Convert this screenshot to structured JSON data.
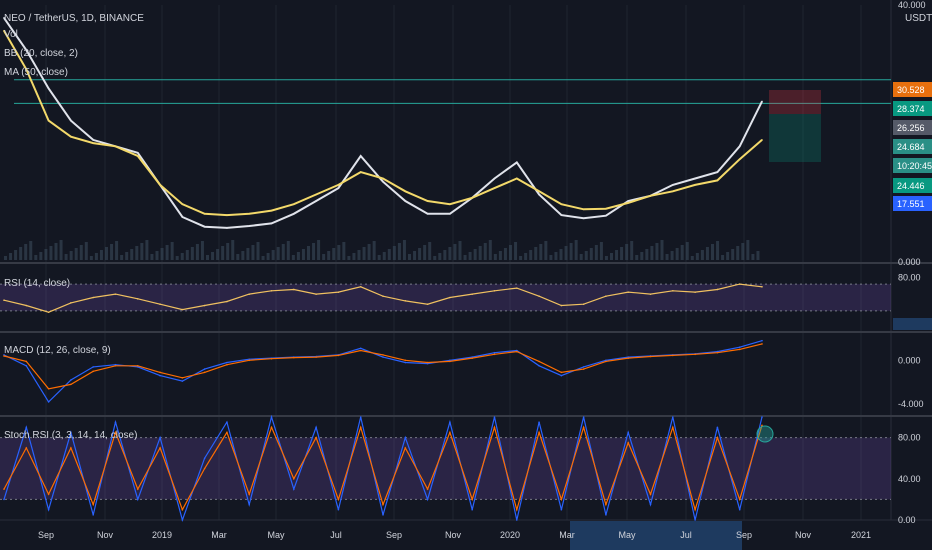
{
  "header": {
    "symbol_title": "NEO / TetherUS, 1D, BINANCE",
    "currency": "USDT",
    "indicators": [
      "Vol",
      "BB (20, close, 2)",
      "MA (50, close)"
    ]
  },
  "chart_data": [
    {
      "type": "line",
      "pane": "price",
      "title": "NEO / TetherUS, 1D, BINANCE",
      "ylim": [
        0,
        40
      ],
      "y_ticks": [
        "40.000",
        "0.000"
      ],
      "x_ticks": [
        "Sep",
        "Nov",
        "2019",
        "Mar",
        "May",
        "Jul",
        "Sep",
        "Nov",
        "2020",
        "Mar",
        "May",
        "Jul",
        "Sep",
        "Nov",
        "2021"
      ],
      "series": [
        {
          "name": "BB (20, close, 2)",
          "color": "#e0e3eb",
          "values": [
            38,
            33,
            27,
            22,
            19,
            18,
            17,
            12,
            7,
            5.5,
            5.3,
            5.6,
            6,
            7.5,
            9.5,
            11.5,
            16.5,
            12.5,
            9.5,
            7.5,
            7.5,
            10,
            13,
            15.5,
            10.5,
            7.3,
            6.8,
            7.2,
            9.5,
            10.3,
            12,
            13,
            14,
            18,
            25
          ]
        },
        {
          "name": "MA (50, close)",
          "color": "#f3d96a",
          "values": [
            36,
            30,
            22,
            19.5,
            18.5,
            18,
            16.5,
            12,
            9,
            7.5,
            7.3,
            7.5,
            8,
            9,
            10.5,
            12,
            14,
            13,
            11,
            9.5,
            9,
            10,
            11.5,
            13,
            11,
            9,
            8.2,
            8.3,
            9.2,
            10.3,
            11,
            12,
            12.7,
            16,
            19
          ]
        }
      ],
      "levels": [
        {
          "value": 28.374,
          "color": "#26a69a"
        },
        {
          "value": 24.684,
          "color": "#26a69a"
        }
      ],
      "price_tags": [
        {
          "text": "30.528",
          "bg": "#e8700e"
        },
        {
          "text": "28.374",
          "bg": "#089981"
        },
        {
          "text": "26.256",
          "bg": "#555a68"
        },
        {
          "text": "24.684",
          "bg": "#2a8f86"
        },
        {
          "text": "10:20:45",
          "bg": "#2a8f86"
        },
        {
          "text": "24.446",
          "bg": "#089981"
        },
        {
          "text": "17.551",
          "bg": "#2962ff"
        }
      ]
    },
    {
      "type": "line",
      "pane": "rsi",
      "title": "RSI (14, close)",
      "y_ticks": [
        "80.00"
      ],
      "ylim": [
        0,
        100
      ],
      "band": [
        30,
        70
      ],
      "series": [
        {
          "name": "RSI",
          "color": "#f0c160",
          "values": [
            46,
            38,
            28,
            42,
            50,
            55,
            48,
            40,
            32,
            38,
            44,
            55,
            60,
            62,
            55,
            58,
            66,
            52,
            45,
            40,
            50,
            55,
            60,
            64,
            52,
            38,
            40,
            52,
            58,
            55,
            60,
            58,
            62,
            70,
            66
          ]
        }
      ]
    },
    {
      "type": "line",
      "pane": "macd",
      "title": "MACD (12, 26, close, 9)",
      "y_ticks": [
        "0.000",
        "-4.000"
      ],
      "ylim": [
        -5,
        2.5
      ],
      "series": [
        {
          "name": "MACD",
          "color": "#2962ff",
          "values": [
            0.5,
            -0.5,
            -3.8,
            -1.8,
            -0.6,
            -0.4,
            -0.6,
            -1.4,
            -1.9,
            -0.8,
            -0.2,
            0.1,
            0.2,
            0.3,
            0.35,
            0.5,
            1.1,
            0.3,
            -0.2,
            -0.3,
            0,
            0.3,
            0.7,
            0.9,
            -0.5,
            -1.4,
            -0.6,
            0,
            0.3,
            0.4,
            0.5,
            0.6,
            0.8,
            1.2,
            1.8
          ]
        },
        {
          "name": "Signal",
          "color": "#ff6d00",
          "values": [
            0.4,
            -0.1,
            -2.6,
            -2.2,
            -1.0,
            -0.5,
            -0.5,
            -1.1,
            -1.6,
            -1.1,
            -0.4,
            0,
            0.15,
            0.25,
            0.3,
            0.45,
            0.9,
            0.5,
            0,
            -0.2,
            -0.1,
            0.2,
            0.55,
            0.8,
            -0.1,
            -1.1,
            -0.8,
            -0.1,
            0.2,
            0.35,
            0.45,
            0.55,
            0.7,
            1.0,
            1.5
          ]
        }
      ]
    },
    {
      "type": "line",
      "pane": "stoch-rsi",
      "title": "Stoch RSI (3, 3, 14, 14, close)",
      "y_ticks": [
        "80.00",
        "40.00",
        "0.00"
      ],
      "ylim": [
        0,
        100
      ],
      "band": [
        20,
        80
      ],
      "series": [
        {
          "name": "K",
          "color": "#2962ff",
          "values": [
            20,
            90,
            10,
            85,
            5,
            95,
            20,
            80,
            0,
            60,
            95,
            15,
            100,
            30,
            90,
            10,
            100,
            5,
            80,
            20,
            95,
            10,
            100,
            0,
            95,
            10,
            100,
            5,
            85,
            15,
            100,
            0,
            90,
            10,
            100
          ]
        },
        {
          "name": "D",
          "color": "#ff6d00",
          "values": [
            30,
            70,
            25,
            70,
            15,
            85,
            30,
            70,
            10,
            50,
            85,
            25,
            90,
            40,
            80,
            20,
            90,
            15,
            70,
            30,
            85,
            20,
            90,
            10,
            85,
            20,
            90,
            15,
            75,
            25,
            90,
            10,
            80,
            20,
            92
          ]
        }
      ]
    }
  ],
  "time_axis": {
    "highlight_label_range": [
      "Mar",
      "Sep"
    ]
  }
}
